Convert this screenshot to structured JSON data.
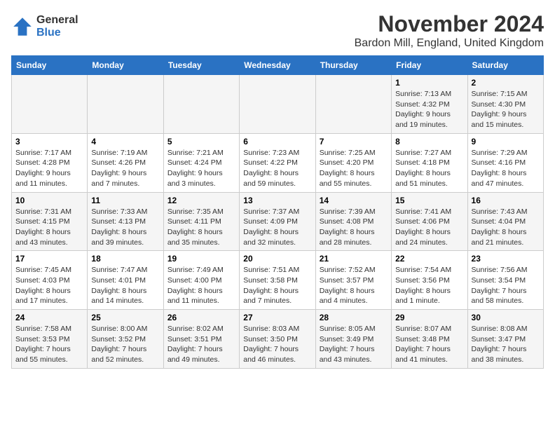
{
  "logo": {
    "general": "General",
    "blue": "Blue"
  },
  "title": "November 2024",
  "subtitle": "Bardon Mill, England, United Kingdom",
  "days_header": [
    "Sunday",
    "Monday",
    "Tuesday",
    "Wednesday",
    "Thursday",
    "Friday",
    "Saturday"
  ],
  "weeks": [
    [
      {
        "day": "",
        "info": ""
      },
      {
        "day": "",
        "info": ""
      },
      {
        "day": "",
        "info": ""
      },
      {
        "day": "",
        "info": ""
      },
      {
        "day": "",
        "info": ""
      },
      {
        "day": "1",
        "info": "Sunrise: 7:13 AM\nSunset: 4:32 PM\nDaylight: 9 hours and 19 minutes."
      },
      {
        "day": "2",
        "info": "Sunrise: 7:15 AM\nSunset: 4:30 PM\nDaylight: 9 hours and 15 minutes."
      }
    ],
    [
      {
        "day": "3",
        "info": "Sunrise: 7:17 AM\nSunset: 4:28 PM\nDaylight: 9 hours and 11 minutes."
      },
      {
        "day": "4",
        "info": "Sunrise: 7:19 AM\nSunset: 4:26 PM\nDaylight: 9 hours and 7 minutes."
      },
      {
        "day": "5",
        "info": "Sunrise: 7:21 AM\nSunset: 4:24 PM\nDaylight: 9 hours and 3 minutes."
      },
      {
        "day": "6",
        "info": "Sunrise: 7:23 AM\nSunset: 4:22 PM\nDaylight: 8 hours and 59 minutes."
      },
      {
        "day": "7",
        "info": "Sunrise: 7:25 AM\nSunset: 4:20 PM\nDaylight: 8 hours and 55 minutes."
      },
      {
        "day": "8",
        "info": "Sunrise: 7:27 AM\nSunset: 4:18 PM\nDaylight: 8 hours and 51 minutes."
      },
      {
        "day": "9",
        "info": "Sunrise: 7:29 AM\nSunset: 4:16 PM\nDaylight: 8 hours and 47 minutes."
      }
    ],
    [
      {
        "day": "10",
        "info": "Sunrise: 7:31 AM\nSunset: 4:15 PM\nDaylight: 8 hours and 43 minutes."
      },
      {
        "day": "11",
        "info": "Sunrise: 7:33 AM\nSunset: 4:13 PM\nDaylight: 8 hours and 39 minutes."
      },
      {
        "day": "12",
        "info": "Sunrise: 7:35 AM\nSunset: 4:11 PM\nDaylight: 8 hours and 35 minutes."
      },
      {
        "day": "13",
        "info": "Sunrise: 7:37 AM\nSunset: 4:09 PM\nDaylight: 8 hours and 32 minutes."
      },
      {
        "day": "14",
        "info": "Sunrise: 7:39 AM\nSunset: 4:08 PM\nDaylight: 8 hours and 28 minutes."
      },
      {
        "day": "15",
        "info": "Sunrise: 7:41 AM\nSunset: 4:06 PM\nDaylight: 8 hours and 24 minutes."
      },
      {
        "day": "16",
        "info": "Sunrise: 7:43 AM\nSunset: 4:04 PM\nDaylight: 8 hours and 21 minutes."
      }
    ],
    [
      {
        "day": "17",
        "info": "Sunrise: 7:45 AM\nSunset: 4:03 PM\nDaylight: 8 hours and 17 minutes."
      },
      {
        "day": "18",
        "info": "Sunrise: 7:47 AM\nSunset: 4:01 PM\nDaylight: 8 hours and 14 minutes."
      },
      {
        "day": "19",
        "info": "Sunrise: 7:49 AM\nSunset: 4:00 PM\nDaylight: 8 hours and 11 minutes."
      },
      {
        "day": "20",
        "info": "Sunrise: 7:51 AM\nSunset: 3:58 PM\nDaylight: 8 hours and 7 minutes."
      },
      {
        "day": "21",
        "info": "Sunrise: 7:52 AM\nSunset: 3:57 PM\nDaylight: 8 hours and 4 minutes."
      },
      {
        "day": "22",
        "info": "Sunrise: 7:54 AM\nSunset: 3:56 PM\nDaylight: 8 hours and 1 minute."
      },
      {
        "day": "23",
        "info": "Sunrise: 7:56 AM\nSunset: 3:54 PM\nDaylight: 7 hours and 58 minutes."
      }
    ],
    [
      {
        "day": "24",
        "info": "Sunrise: 7:58 AM\nSunset: 3:53 PM\nDaylight: 7 hours and 55 minutes."
      },
      {
        "day": "25",
        "info": "Sunrise: 8:00 AM\nSunset: 3:52 PM\nDaylight: 7 hours and 52 minutes."
      },
      {
        "day": "26",
        "info": "Sunrise: 8:02 AM\nSunset: 3:51 PM\nDaylight: 7 hours and 49 minutes."
      },
      {
        "day": "27",
        "info": "Sunrise: 8:03 AM\nSunset: 3:50 PM\nDaylight: 7 hours and 46 minutes."
      },
      {
        "day": "28",
        "info": "Sunrise: 8:05 AM\nSunset: 3:49 PM\nDaylight: 7 hours and 43 minutes."
      },
      {
        "day": "29",
        "info": "Sunrise: 8:07 AM\nSunset: 3:48 PM\nDaylight: 7 hours and 41 minutes."
      },
      {
        "day": "30",
        "info": "Sunrise: 8:08 AM\nSunset: 3:47 PM\nDaylight: 7 hours and 38 minutes."
      }
    ]
  ]
}
